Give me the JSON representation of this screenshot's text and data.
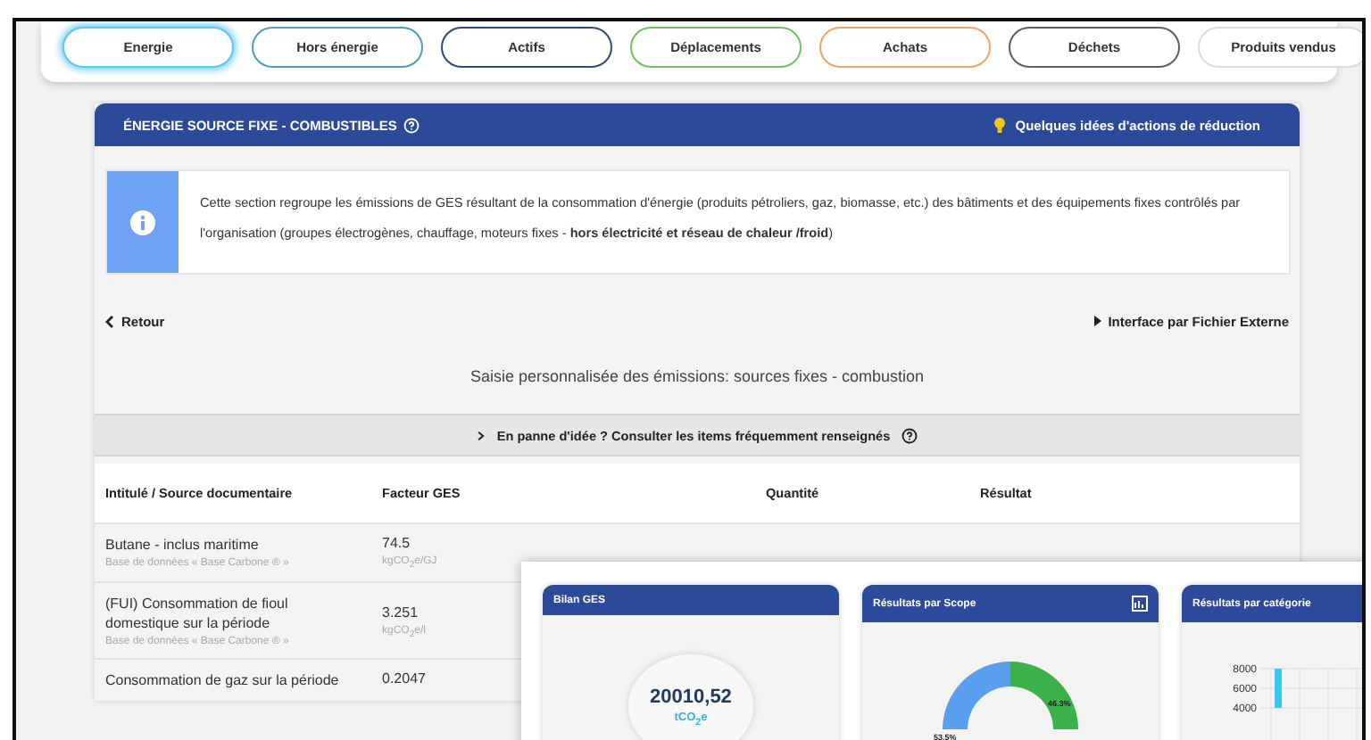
{
  "tabs": [
    {
      "label": "Energie",
      "selected": true,
      "color": "#5bc8f0"
    },
    {
      "label": "Hors énergie",
      "selected": false,
      "color": "#4a9fc0"
    },
    {
      "label": "Actifs",
      "selected": false,
      "color": "#2e4a7a"
    },
    {
      "label": "Déplacements",
      "selected": false,
      "color": "#72c060"
    },
    {
      "label": "Achats",
      "selected": false,
      "color": "#f5a360"
    },
    {
      "label": "Déchets",
      "selected": false,
      "color": "#5a5f66"
    },
    {
      "label": "Produits vendus",
      "selected": false,
      "color": "#d8dbe0"
    }
  ],
  "section": {
    "title": "ÉNERGIE SOURCE FIXE - COMBUSTIBLES",
    "ideas_link": "Quelques idées d'actions de réduction",
    "info": "Cette section regroupe les émissions de GES résultant de la consommation d'énergie (produits pétroliers, gaz, biomasse, etc.) des bâtiments et des équipements fixes contrôlés par l'organisation (groupes électrogènes, chauffage, moteurs fixes - **hors électricité et réseau de chaleur /froid**)",
    "back": "Retour",
    "external": "Interface par Fichier Externe",
    "subtitle": "Saisie personnalisée des émissions: sources fixes - combustion",
    "ideas_toggle": {
      "label": "En panne d'idée ? Consulter les items fréquemment renseignés",
      "expanded": false
    }
  },
  "table": {
    "columns": [
      "Intitulé / Source documentaire",
      "Facteur GES",
      "Quantité",
      "Résultat"
    ],
    "rows": [
      {
        "name": "Butane - inclus maritime",
        "source": "Base de données « Base Carbone ® »",
        "factor": "74.5",
        "unit": "kgCO$_{2}$e/GJ"
      },
      {
        "name": "(FUI) Consommation de fioul domestique sur la période",
        "source": "Base de données « Base Carbone ® »",
        "factor": "3.251",
        "unit": "kgCO$_{2}$e/l"
      },
      {
        "name": "Consommation de gaz sur la période",
        "factor": "0.2047"
      }
    ]
  },
  "dashboard": {
    "cards": [
      {
        "kind": "total",
        "title": "Bilan GES",
        "value": "20010,52",
        "unit": "tCO$_{2}$e"
      },
      {
        "kind": "donut",
        "title": "Résultats par Scope",
        "labels": [
          "53.5%",
          "46.3%"
        ]
      },
      {
        "kind": "bar",
        "title": "Résultats par catégorie",
        "chart_data": {
          "type": "bar",
          "values": [
            8000
          ],
          "yticks": [
            {
              "value": 4000,
              "label": "4000"
            },
            {
              "value": 6000,
              "label": "6000"
            },
            {
              "value": 8000,
              "label": "8000"
            }
          ],
          "ylim": [
            4000,
            8000
          ],
          "grid": true
        }
      }
    ]
  }
}
